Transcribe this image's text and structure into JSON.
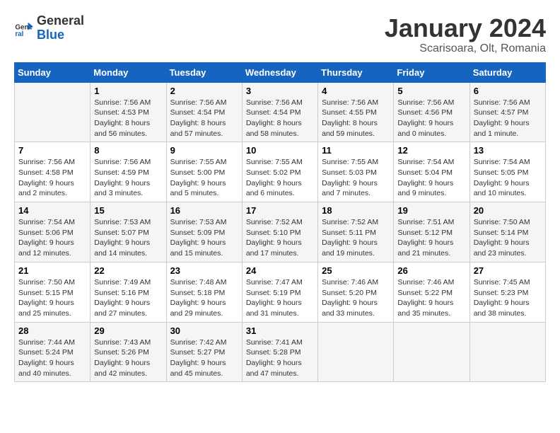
{
  "header": {
    "logo_general": "General",
    "logo_blue": "Blue",
    "title": "January 2024",
    "subtitle": "Scarisoara, Olt, Romania"
  },
  "weekdays": [
    "Sunday",
    "Monday",
    "Tuesday",
    "Wednesday",
    "Thursday",
    "Friday",
    "Saturday"
  ],
  "weeks": [
    [
      {
        "day": "",
        "info": ""
      },
      {
        "day": "1",
        "info": "Sunrise: 7:56 AM\nSunset: 4:53 PM\nDaylight: 8 hours\nand 56 minutes."
      },
      {
        "day": "2",
        "info": "Sunrise: 7:56 AM\nSunset: 4:54 PM\nDaylight: 8 hours\nand 57 minutes."
      },
      {
        "day": "3",
        "info": "Sunrise: 7:56 AM\nSunset: 4:54 PM\nDaylight: 8 hours\nand 58 minutes."
      },
      {
        "day": "4",
        "info": "Sunrise: 7:56 AM\nSunset: 4:55 PM\nDaylight: 8 hours\nand 59 minutes."
      },
      {
        "day": "5",
        "info": "Sunrise: 7:56 AM\nSunset: 4:56 PM\nDaylight: 9 hours\nand 0 minutes."
      },
      {
        "day": "6",
        "info": "Sunrise: 7:56 AM\nSunset: 4:57 PM\nDaylight: 9 hours\nand 1 minute."
      }
    ],
    [
      {
        "day": "7",
        "info": "Sunrise: 7:56 AM\nSunset: 4:58 PM\nDaylight: 9 hours\nand 2 minutes."
      },
      {
        "day": "8",
        "info": "Sunrise: 7:56 AM\nSunset: 4:59 PM\nDaylight: 9 hours\nand 3 minutes."
      },
      {
        "day": "9",
        "info": "Sunrise: 7:55 AM\nSunset: 5:00 PM\nDaylight: 9 hours\nand 5 minutes."
      },
      {
        "day": "10",
        "info": "Sunrise: 7:55 AM\nSunset: 5:02 PM\nDaylight: 9 hours\nand 6 minutes."
      },
      {
        "day": "11",
        "info": "Sunrise: 7:55 AM\nSunset: 5:03 PM\nDaylight: 9 hours\nand 7 minutes."
      },
      {
        "day": "12",
        "info": "Sunrise: 7:54 AM\nSunset: 5:04 PM\nDaylight: 9 hours\nand 9 minutes."
      },
      {
        "day": "13",
        "info": "Sunrise: 7:54 AM\nSunset: 5:05 PM\nDaylight: 9 hours\nand 10 minutes."
      }
    ],
    [
      {
        "day": "14",
        "info": "Sunrise: 7:54 AM\nSunset: 5:06 PM\nDaylight: 9 hours\nand 12 minutes."
      },
      {
        "day": "15",
        "info": "Sunrise: 7:53 AM\nSunset: 5:07 PM\nDaylight: 9 hours\nand 14 minutes."
      },
      {
        "day": "16",
        "info": "Sunrise: 7:53 AM\nSunset: 5:09 PM\nDaylight: 9 hours\nand 15 minutes."
      },
      {
        "day": "17",
        "info": "Sunrise: 7:52 AM\nSunset: 5:10 PM\nDaylight: 9 hours\nand 17 minutes."
      },
      {
        "day": "18",
        "info": "Sunrise: 7:52 AM\nSunset: 5:11 PM\nDaylight: 9 hours\nand 19 minutes."
      },
      {
        "day": "19",
        "info": "Sunrise: 7:51 AM\nSunset: 5:12 PM\nDaylight: 9 hours\nand 21 minutes."
      },
      {
        "day": "20",
        "info": "Sunrise: 7:50 AM\nSunset: 5:14 PM\nDaylight: 9 hours\nand 23 minutes."
      }
    ],
    [
      {
        "day": "21",
        "info": "Sunrise: 7:50 AM\nSunset: 5:15 PM\nDaylight: 9 hours\nand 25 minutes."
      },
      {
        "day": "22",
        "info": "Sunrise: 7:49 AM\nSunset: 5:16 PM\nDaylight: 9 hours\nand 27 minutes."
      },
      {
        "day": "23",
        "info": "Sunrise: 7:48 AM\nSunset: 5:18 PM\nDaylight: 9 hours\nand 29 minutes."
      },
      {
        "day": "24",
        "info": "Sunrise: 7:47 AM\nSunset: 5:19 PM\nDaylight: 9 hours\nand 31 minutes."
      },
      {
        "day": "25",
        "info": "Sunrise: 7:46 AM\nSunset: 5:20 PM\nDaylight: 9 hours\nand 33 minutes."
      },
      {
        "day": "26",
        "info": "Sunrise: 7:46 AM\nSunset: 5:22 PM\nDaylight: 9 hours\nand 35 minutes."
      },
      {
        "day": "27",
        "info": "Sunrise: 7:45 AM\nSunset: 5:23 PM\nDaylight: 9 hours\nand 38 minutes."
      }
    ],
    [
      {
        "day": "28",
        "info": "Sunrise: 7:44 AM\nSunset: 5:24 PM\nDaylight: 9 hours\nand 40 minutes."
      },
      {
        "day": "29",
        "info": "Sunrise: 7:43 AM\nSunset: 5:26 PM\nDaylight: 9 hours\nand 42 minutes."
      },
      {
        "day": "30",
        "info": "Sunrise: 7:42 AM\nSunset: 5:27 PM\nDaylight: 9 hours\nand 45 minutes."
      },
      {
        "day": "31",
        "info": "Sunrise: 7:41 AM\nSunset: 5:28 PM\nDaylight: 9 hours\nand 47 minutes."
      },
      {
        "day": "",
        "info": ""
      },
      {
        "day": "",
        "info": ""
      },
      {
        "day": "",
        "info": ""
      }
    ]
  ]
}
